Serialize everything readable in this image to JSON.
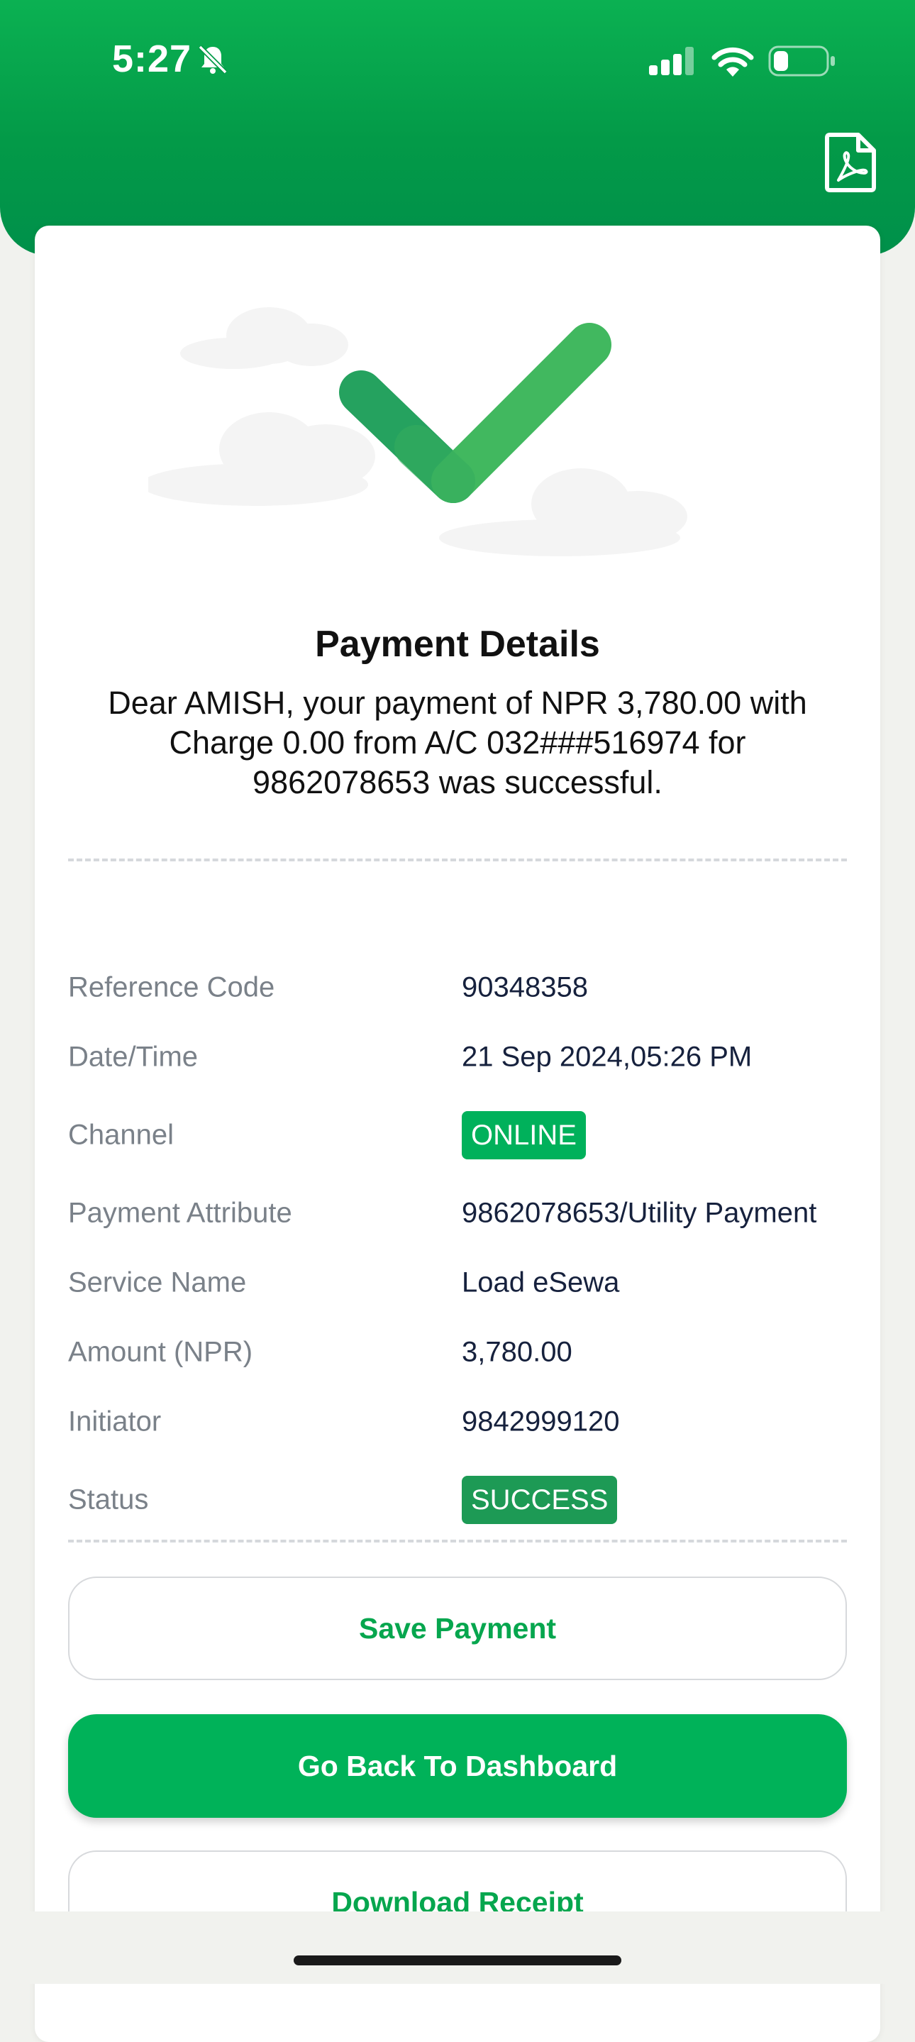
{
  "status_bar": {
    "time": "5:27",
    "icons": [
      "bell-slash-icon",
      "signal-icon",
      "wifi-icon",
      "battery-icon"
    ]
  },
  "header": {
    "pdf_icon": "pdf-file-icon"
  },
  "hero": {
    "icon": "success-check-icon"
  },
  "payment": {
    "title": "Payment Details",
    "message": "Dear AMISH, your payment of NPR 3,780.00 with Charge 0.00 from A/C 032###516974 for 9862078653 was successful.",
    "details": [
      {
        "label": "Reference Code",
        "value": "90348358"
      },
      {
        "label": "Date/Time",
        "value": "21 Sep 2024,05:26 PM"
      },
      {
        "label": "Channel",
        "value": "ONLINE"
      },
      {
        "label": "Payment Attribute",
        "value": "9862078653/Utility Payment"
      },
      {
        "label": "Service Name",
        "value": "Load eSewa"
      },
      {
        "label": "Amount (NPR)",
        "value": "3,780.00"
      },
      {
        "label": "Initiator",
        "value": "9842999120"
      },
      {
        "label": "Status",
        "value": "SUCCESS"
      }
    ]
  },
  "actions": {
    "save": "Save Payment",
    "dashboard": "Go Back To Dashboard",
    "download": "Download Receipt"
  },
  "colors": {
    "brand_green": "#00b259",
    "header_green": "#039a48",
    "status_badge": "#1d9a55",
    "channel_badge": "#00b15b"
  }
}
